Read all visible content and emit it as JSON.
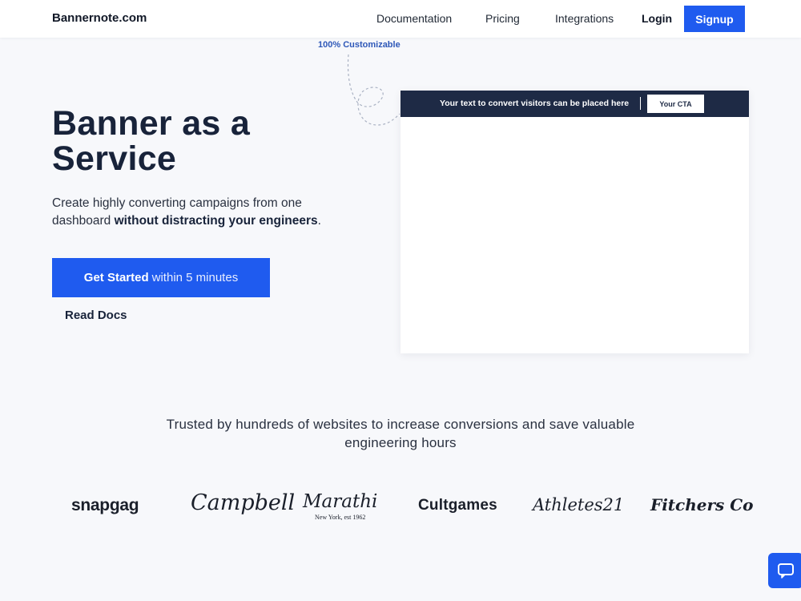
{
  "header": {
    "brand": "Bannernote.com",
    "nav": {
      "documentation": "Documentation",
      "pricing": "Pricing",
      "integrations": "Integrations",
      "login": "Login",
      "signup": "Signup"
    }
  },
  "hero": {
    "tag": "100% Customizable",
    "title_line1": "Banner as a",
    "title_line2": "Service",
    "subtitle_plain": "Create highly converting campaigns from one dashboard",
    "subtitle_bold": "without distracting your engineers",
    "subtitle_end": ".",
    "cta_strong": "Get Started",
    "cta_light": "within 5 minutes",
    "secondary_link": "Read Docs"
  },
  "preview": {
    "banner_text": "Your text to convert visitors can be placed here",
    "cta_label": "Your CTA"
  },
  "trusted": {
    "text": "Trusted by hundreds of websites to increase conversions and save valuable engineering hours",
    "logos": {
      "snapgag": "snapgag",
      "campbell": "Campbell",
      "marathi": "Marathi",
      "marathi_sub": "New York, est 1962",
      "cultgames": "Cultgames",
      "athletes": "Athletes21",
      "fitchers": "Fitchers Co"
    }
  },
  "icons": {
    "chat": "chat-bubble-icon",
    "doodle": "dashed-loop-arrow-icon"
  },
  "colors": {
    "accent": "#1f5bef",
    "banner_bg": "#1e2a45",
    "tag_text": "#2e58b8",
    "page_bg": "#f7f8fb"
  }
}
